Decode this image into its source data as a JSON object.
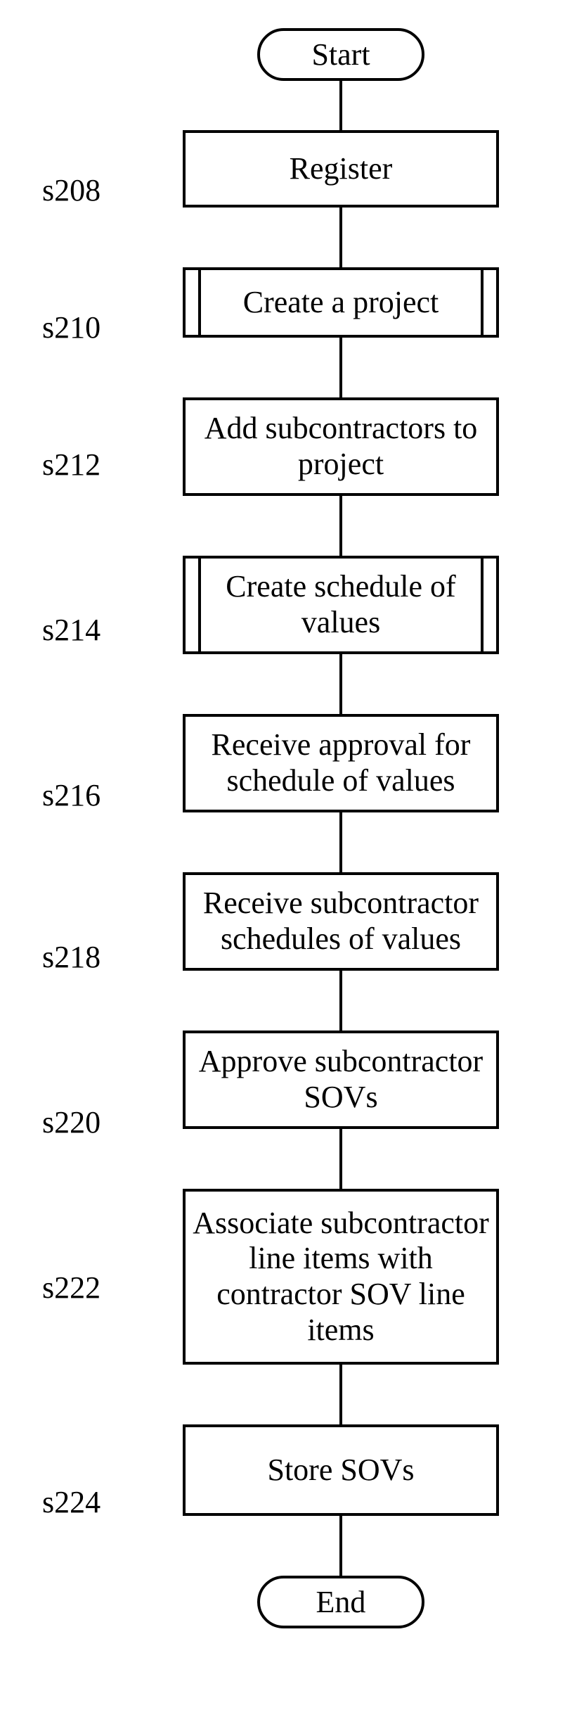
{
  "start": "Start",
  "end": "End",
  "steps": {
    "s208": {
      "id": "s208",
      "text": "Register"
    },
    "s210": {
      "id": "s210",
      "text": "Create a project"
    },
    "s212": {
      "id": "s212",
      "text": "Add subcontractors to project"
    },
    "s214": {
      "id": "s214",
      "text": "Create schedule of values"
    },
    "s216": {
      "id": "s216",
      "text": "Receive approval for schedule of values"
    },
    "s218": {
      "id": "s218",
      "text": "Receive subcontractor schedules of values"
    },
    "s220": {
      "id": "s220",
      "text": "Approve subcontractor SOVs"
    },
    "s222": {
      "id": "s222",
      "text": "Associate subcontractor line items with contractor SOV line items"
    },
    "s224": {
      "id": "s224",
      "text": "Store SOVs"
    }
  }
}
